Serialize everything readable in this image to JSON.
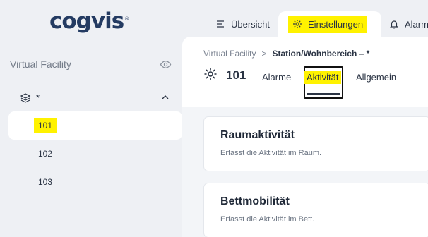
{
  "logo": {
    "text": "cogvis",
    "mark": "®"
  },
  "top_tabs": [
    {
      "label": "Übersicht",
      "icon": "list-icon"
    },
    {
      "label": "Einstellungen",
      "icon": "gear-icon",
      "active": true
    },
    {
      "label": "Alarm",
      "icon": "bell-icon"
    }
  ],
  "sidebar": {
    "title": "Virtual Facility",
    "group_label": "*",
    "rooms": [
      {
        "label": "101",
        "active": true
      },
      {
        "label": "102"
      },
      {
        "label": "103"
      }
    ]
  },
  "breadcrumb": {
    "root": "Virtual Facility",
    "separator": ">",
    "current": "Station/Wohnbereich – *"
  },
  "page": {
    "title": "101",
    "tabs": [
      {
        "label": "Alarme"
      },
      {
        "label": "Aktivität",
        "active": true
      },
      {
        "label": "Allgemein"
      }
    ]
  },
  "cards": [
    {
      "title": "Raumaktivität",
      "description": "Erfasst die Aktivität im Raum."
    },
    {
      "title": "Bettmobilität",
      "description": "Erfasst die Aktivität im Bett."
    }
  ],
  "colors": {
    "highlight": "#fff200",
    "brand": "#243b62",
    "background": "#eef0f4"
  }
}
